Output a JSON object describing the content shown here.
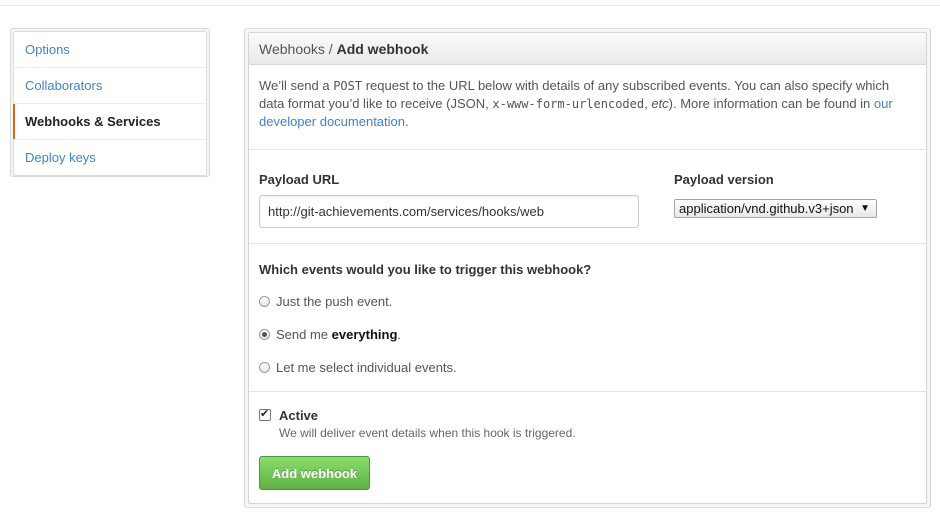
{
  "sidebar": {
    "items": [
      {
        "label": "Options"
      },
      {
        "label": "Collaborators"
      },
      {
        "label": "Webhooks & Services"
      },
      {
        "label": "Deploy keys"
      }
    ]
  },
  "header": {
    "breadcrumb_parent": "Webhooks",
    "separator": "/",
    "title": "Add webhook"
  },
  "intro": {
    "text_1": "We’ll send a ",
    "code_1": "POST",
    "text_2": " request to the URL below with details of any subscribed events. You can also specify which data format you’d like to receive (JSON, ",
    "code_2": "x-www-form-urlencoded",
    "text_3": ", ",
    "etc": "etc",
    "text_4": "). More information can be found in ",
    "link": "our developer documentation",
    "text_5": "."
  },
  "form": {
    "payload_url_label": "Payload URL",
    "payload_url_value": "http://git-achievements.com/services/hooks/web",
    "payload_version_label": "Payload version",
    "payload_version_value": "application/vnd.github.v3+json",
    "dropdown_arrow": "▼"
  },
  "events": {
    "question": "Which events would you like to trigger this webhook?",
    "options": [
      {
        "label": "Just the push event.",
        "checked": false
      },
      {
        "prefix": "Send me ",
        "bold": "everything",
        "suffix": ".",
        "checked": true
      },
      {
        "label": "Let me select individual events.",
        "checked": false
      }
    ]
  },
  "active": {
    "label": "Active",
    "checked": true,
    "description": "We will deliver event details when this hook is triggered."
  },
  "submit": {
    "label": "Add webhook"
  },
  "colors": {
    "link": "#4183c4",
    "selected_marker": "#d26911",
    "button_green": "#60b044"
  }
}
